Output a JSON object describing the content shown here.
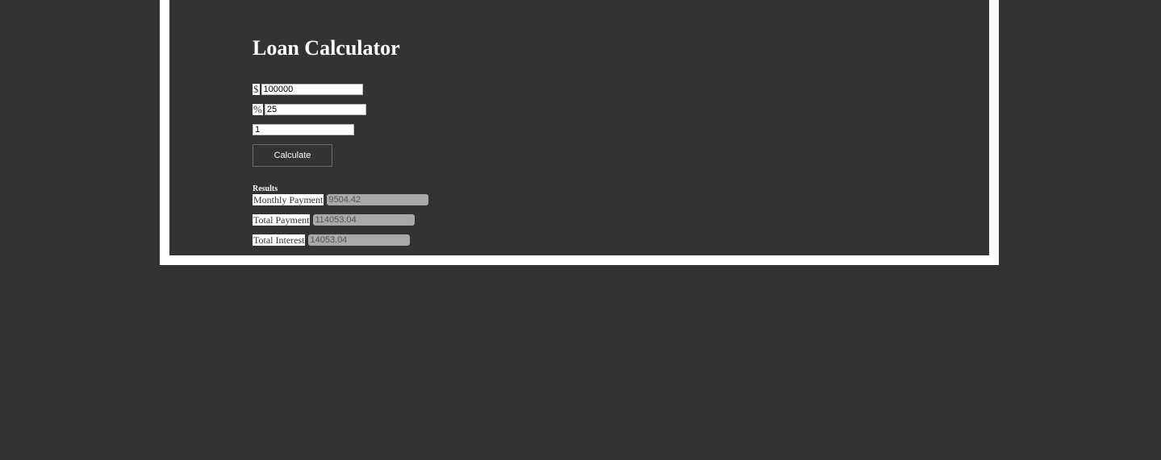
{
  "page": {
    "title": "Loan Calculator"
  },
  "form": {
    "amount": {
      "prefix": "$",
      "value": "100000"
    },
    "interest": {
      "prefix": "%",
      "value": "25"
    },
    "years": {
      "value": "1"
    },
    "calculate_label": "Calculate"
  },
  "results": {
    "heading": "Results",
    "monthly_payment": {
      "label": "Monthly Payment",
      "value": "9504.42"
    },
    "total_payment": {
      "label": "Total Payment",
      "value": "114053.04"
    },
    "total_interest": {
      "label": "Total Interest",
      "value": "14053.04"
    }
  },
  "colors": {
    "background": "#333333",
    "frame": "#ffffff",
    "output_field": "#a9a9a9"
  }
}
